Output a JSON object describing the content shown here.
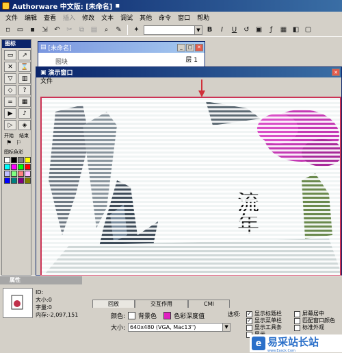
{
  "app": {
    "title": "Authorware 中文版: [未命名]",
    "close_glyph": "▪"
  },
  "menu": [
    "文件",
    "编辑",
    "查看",
    "插入",
    "修改",
    "文本",
    "调试",
    "其他",
    "命令",
    "窗口",
    "帮助"
  ],
  "menu_disabled": [
    false,
    false,
    false,
    true,
    false,
    false,
    false,
    false,
    false,
    false,
    false
  ],
  "toolbar": {
    "bold": "B",
    "italic": "I",
    "underline": "U"
  },
  "icon_palette": {
    "title": "图标",
    "start_label": "开始",
    "end_label": "结束",
    "color_label": "图标色彩",
    "colors": [
      "#ffffff",
      "#000000",
      "#808080",
      "#ffff00",
      "#00ffff",
      "#ff00ff",
      "#00ff00",
      "#ff0000",
      "#c0c0ff",
      "#80ff80",
      "#ff8080",
      "#ffc0ff",
      "#0000ff",
      "#008080",
      "#800080",
      "#808000"
    ]
  },
  "design_window": {
    "title": "[未命名]",
    "level": "层 1",
    "item": "图块"
  },
  "presentation_window": {
    "title": "演示窗口",
    "menu_file": "文件",
    "canvas_text": "流年"
  },
  "properties": {
    "title": "属性",
    "info_1": "ID:",
    "info_2": "大小:0",
    "info_3": "字量:0",
    "info_4": "内存:-2,097,151",
    "tabs": [
      "回放",
      "交互作用",
      "CMI"
    ],
    "color_label": "颜色:",
    "bg_color_label": "背景色",
    "chroma_label": "色彩深度值",
    "size_label": "大小:",
    "size_value": "640x480 (VGA, Mac13\")",
    "options_label": "选项:",
    "options_col1": [
      "显示标题栏",
      "显示菜单栏",
      "显示工具条",
      "显示"
    ],
    "options_col1_checked": [
      true,
      true,
      false,
      false
    ],
    "options_col2": [
      "屏幕居中",
      "匹配窗口颜色",
      "标准外观"
    ],
    "options_col2_checked": [
      false,
      false,
      false
    ],
    "colors": {
      "bg": "#ffffff",
      "chroma": "#e020c0"
    }
  },
  "watermark": {
    "text": "易采站长站",
    "url": "www.Easck.Com"
  }
}
